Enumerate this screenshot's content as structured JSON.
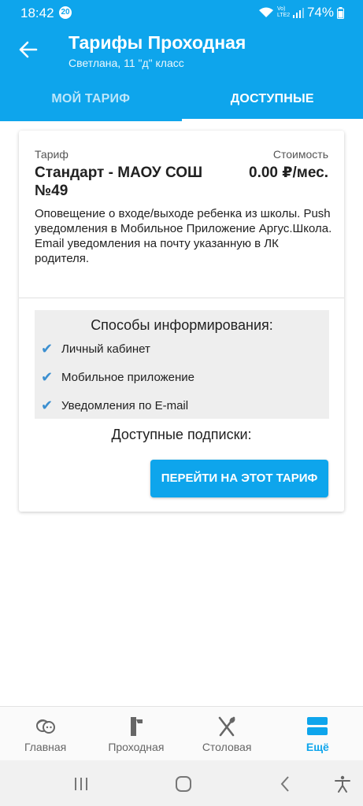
{
  "status_bar": {
    "time": "18:42",
    "notification_count": "20",
    "network": "Vo) LTE2",
    "battery": "74%"
  },
  "app_bar": {
    "title": "Тарифы Проходная",
    "subtitle": "Светлана, 11 \"д\" класс"
  },
  "tabs": [
    {
      "label": "МОЙ ТАРИФ",
      "active": false
    },
    {
      "label": "ДОСТУПНЫЕ",
      "active": true
    }
  ],
  "card": {
    "tariff_label": "Тариф",
    "cost_label": "Стоимость",
    "tariff_name": "Стандарт - МАОУ СОШ №49",
    "price": "0.00 ₽/мес.",
    "description_line1": "Оповещение о входе/выходе ребенка из школы. Push уведомления в Мобильное Приложение Аргус.Школа.",
    "description_line2": "Email уведомления на почту указанную в ЛК родителя.",
    "methods_title": "Способы информирования:",
    "methods": [
      "Личный кабинет",
      "Мобильное приложение",
      "Уведомления по E-mail"
    ],
    "subscriptions_title": "Доступные подписки:",
    "switch_button": "ПЕРЕЙТИ НА ЭТОТ ТАРИФ"
  },
  "bottom_nav": [
    {
      "label": "Главная",
      "icon": "faces-icon",
      "active": false
    },
    {
      "label": "Проходная",
      "icon": "turnstile-icon",
      "active": false
    },
    {
      "label": "Столовая",
      "icon": "fork-spoon-icon",
      "active": false
    },
    {
      "label": "Ещё",
      "icon": "menu-icon",
      "active": true
    }
  ],
  "colors": {
    "primary": "#0EA5EC",
    "check": "#3B8FD0",
    "methods_bg": "#eeeeee"
  }
}
